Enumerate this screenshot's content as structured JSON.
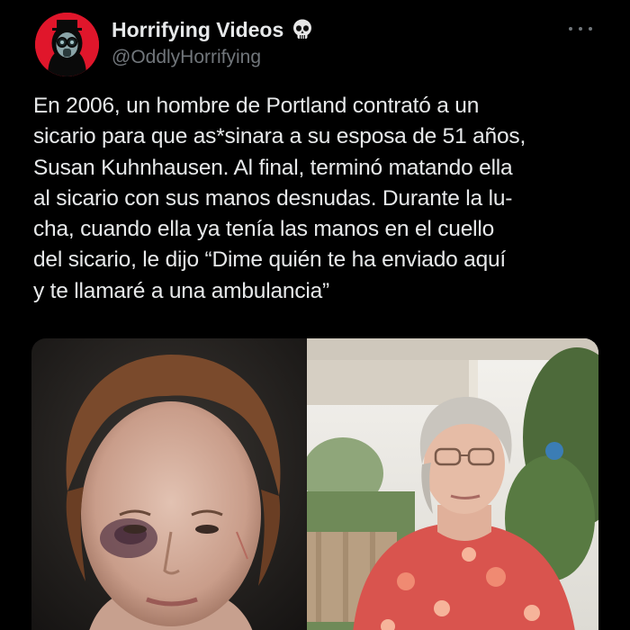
{
  "author": {
    "display_name": "Horrifying Videos",
    "handle": "@OddlyHorrifying",
    "avatar_icon": "hooded-figure-avatar",
    "verified_emoji_icon": "skull-icon",
    "avatar_color": "#e0162b"
  },
  "tweet": {
    "text": "En 2006, un hombre de Portland contrató a un\nsicario para que as*sinara a su esposa de 51 años,\nSusan Kuhnhausen. Al final, terminó matando ella\nal sicario con sus manos desnudas. Durante la lu-\ncha, cuando ella ya tenía las manos en el cuello\ndel sicario, le dijo “Dime quién te ha enviado aquí\ny te llamaré a una ambulancia”"
  },
  "media": {
    "photos": [
      "left-photo-injured-face",
      "right-photo-woman-on-porch"
    ]
  },
  "theme": {
    "background": "#000000",
    "text": "#e7e9ea",
    "secondary_text": "#71767b"
  }
}
